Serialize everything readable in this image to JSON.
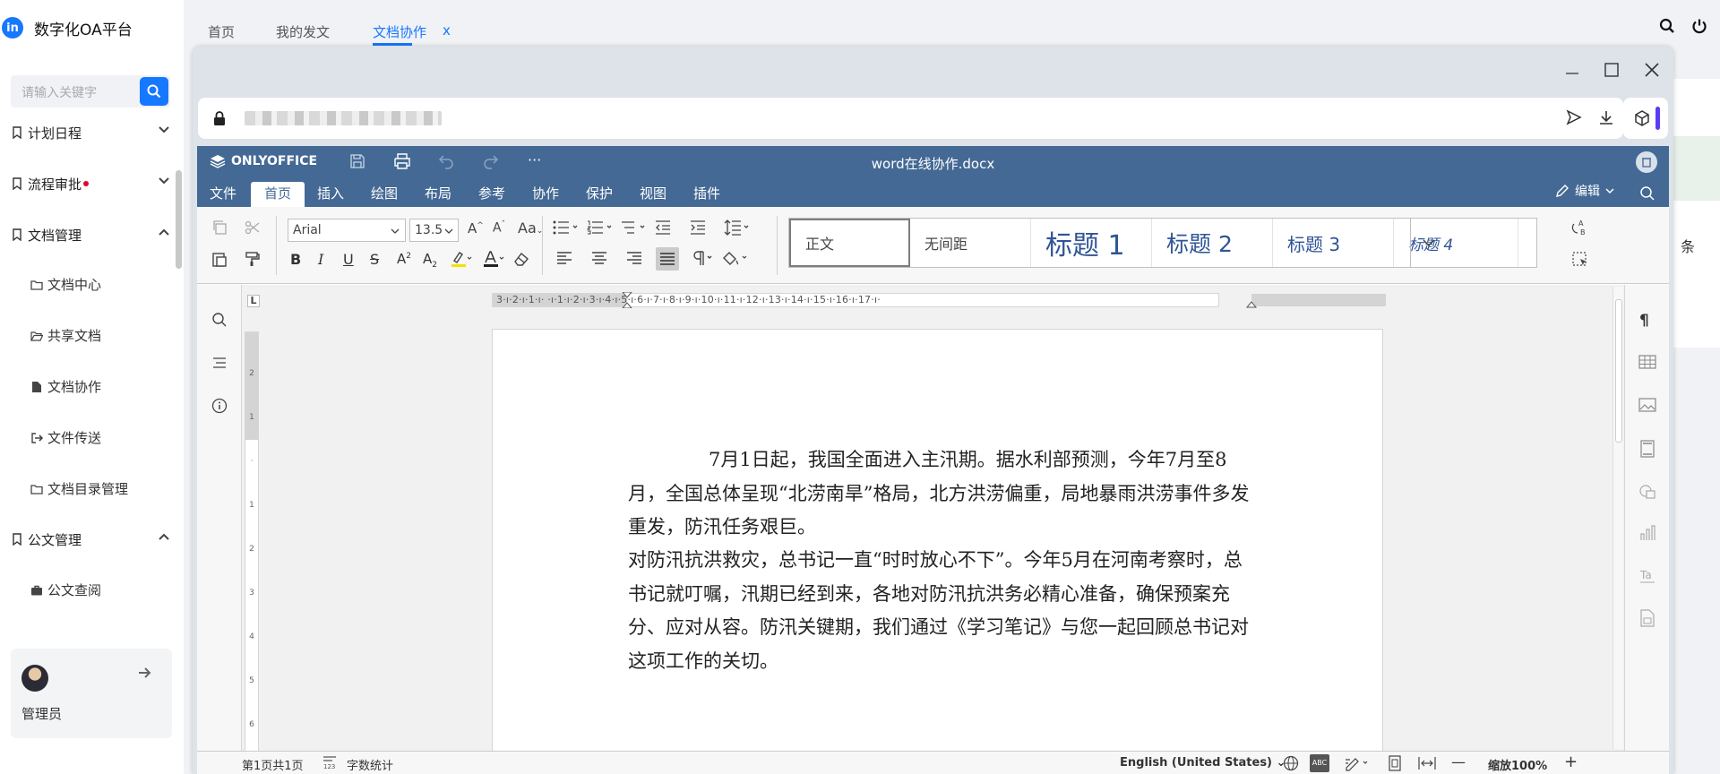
{
  "app": {
    "title": "数字化OA平台",
    "logo_text": "in"
  },
  "sidebar": {
    "search_placeholder": "请输入关键字",
    "menu": {
      "plan": "计划日程",
      "approval": "流程审批",
      "docs": "文档管理",
      "official": "公文管理"
    },
    "sub": {
      "doc_center": "文档中心",
      "shared": "共享文档",
      "collab": "文档协作",
      "transfer": "文件传送",
      "catalog": "文档目录管理",
      "official_query": "公文查阅"
    },
    "user": {
      "name": "管理员"
    }
  },
  "tabs": {
    "home": "首页",
    "my_docs": "我的发文",
    "collab": "文档协作",
    "close": "x"
  },
  "background": {
    "partial_text": "条"
  },
  "editor": {
    "brand": "ONLYOFFICE",
    "filename": "word在线协作.docx",
    "ribbon_tabs": [
      "文件",
      "首页",
      "插入",
      "绘图",
      "布局",
      "参考",
      "协作",
      "保护",
      "视图",
      "插件"
    ],
    "edit_mode": "编辑",
    "font_name": "Arial",
    "font_size": "13.5",
    "styles": [
      "正文",
      "无间距",
      "标题 1",
      "标题 2",
      "标题 3",
      "标题 4"
    ],
    "ruler_h": "3·ı·2·ı·1·ı·  ·ı·1·ı·2·ı·3·ı·4·ı·5·ı·6·ı·7·ı·8·ı·9·ı·10·ı·11·ı·12·ı·13·ı·14·ı·15·ı·16·ı·17·ı·",
    "paragraphs": [
      "7月1日起，我国全面进入主汛期。据水利部预测，今年7月至8月，全国总体呈现“北涝南旱”格局，北方洪涝偏重，局地暴雨洪涝事件多发重发，防汛任务艰巨。",
      "对防汛抗洪救灾，总书记一直“时时放心不下”。今年5月在河南考察时，总书记就叮嘱，汛期已经到来，各地对防汛抗洪务必精心准备，确保预案充分、应对从容。防汛关键期，我们通过《学习笔记》与您一起回顾总书记对这项工作的关切。"
    ],
    "status": {
      "page": "第1页共1页",
      "word_count": "字数统计",
      "language": "English (United States)",
      "zoom": "缩放100%"
    }
  },
  "colors": {
    "accent": "#1677ff",
    "oo_header": "#446995",
    "notify": "#e4002b"
  }
}
